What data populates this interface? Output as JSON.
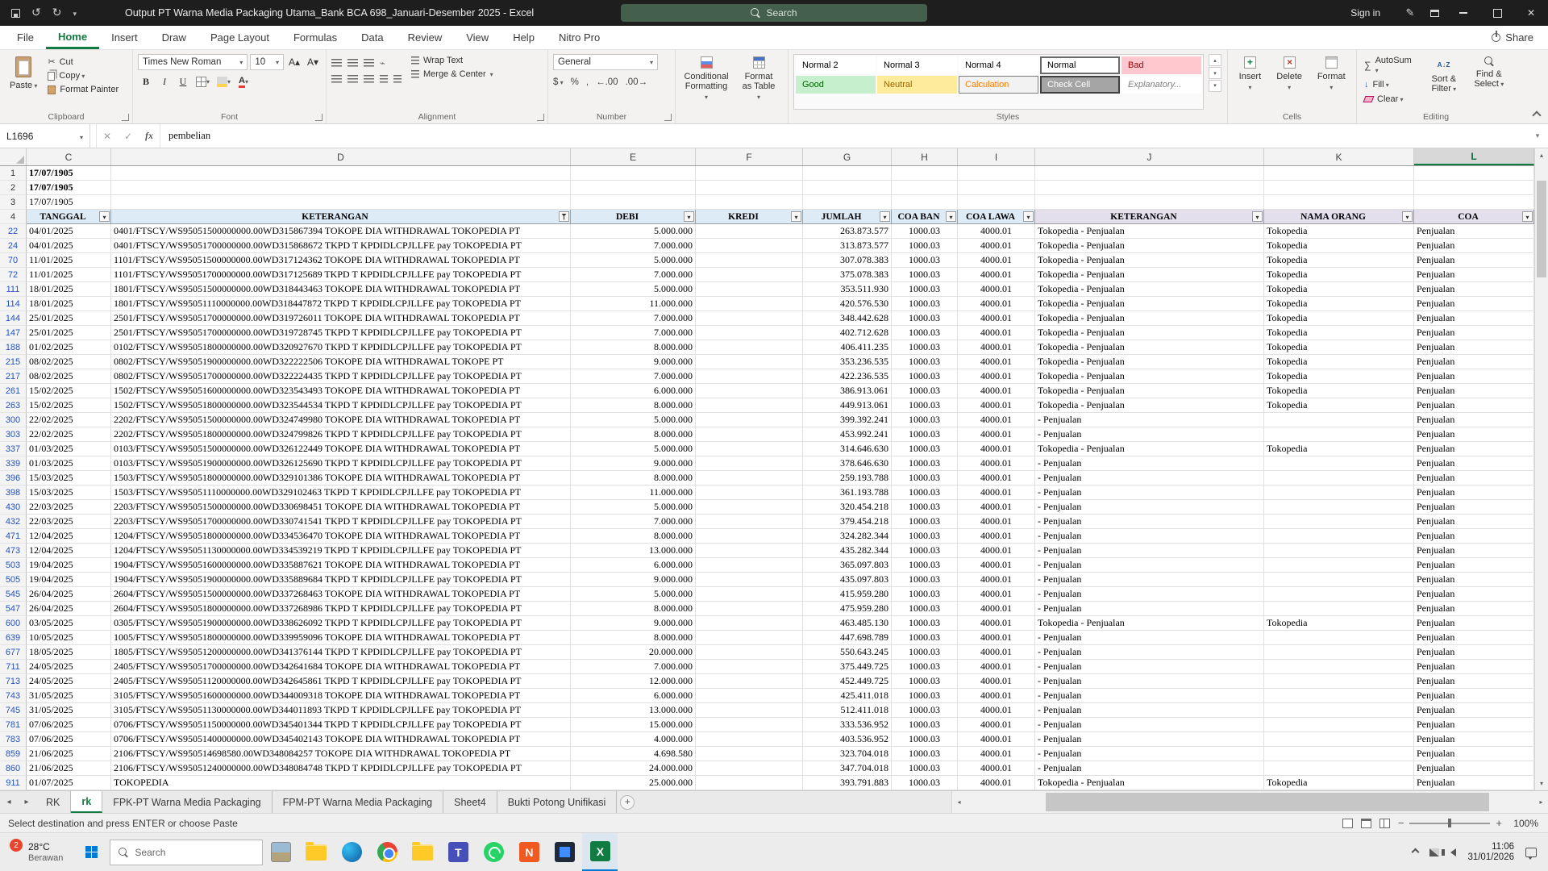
{
  "title_bar": {
    "title": "Output PT Warna Media Packaging Utama_Bank BCA 698_Januari-Desember 2025 - Excel",
    "search": "Search",
    "sign_in": "Sign in"
  },
  "ribbon": {
    "tabs": [
      "File",
      "Home",
      "Insert",
      "Draw",
      "Page Layout",
      "Formulas",
      "Data",
      "Review",
      "View",
      "Help",
      "Nitro Pro"
    ],
    "active_tab": "Home",
    "share": "Share",
    "clipboard": {
      "label": "Clipboard",
      "paste": "Paste",
      "cut": "Cut",
      "copy": "Copy",
      "painter": "Format Painter"
    },
    "font": {
      "label": "Font",
      "name": "Times New Roman",
      "size": "10",
      "bold": "B",
      "italic": "I",
      "underline": "U"
    },
    "alignment": {
      "label": "Alignment",
      "wrap": "Wrap Text",
      "merge": "Merge & Center"
    },
    "number": {
      "label": "Number",
      "format": "General"
    },
    "styles": {
      "label": "Styles",
      "conditional": "Conditional Formatting",
      "format_table": "Format as Table",
      "gallery": [
        [
          "Normal 2",
          "Normal 3",
          "Normal 4",
          "Normal",
          "Bad"
        ],
        [
          "Good",
          "Neutral",
          "Calculation",
          "Check Cell",
          "Explanatory..."
        ]
      ]
    },
    "cells": {
      "label": "Cells",
      "insert": "Insert",
      "delete": "Delete",
      "format": "Format"
    },
    "editing": {
      "label": "Editing",
      "autosum": "AutoSum",
      "fill": "Fill",
      "clear": "Clear",
      "sort": "Sort & Filter",
      "find": "Find & Select"
    }
  },
  "formula_bar": {
    "name_box": "L1696",
    "fx": "fx",
    "value": "pembelian"
  },
  "grid": {
    "columns": [
      "C",
      "D",
      "E",
      "F",
      "G",
      "H",
      "I",
      "J",
      "K",
      "L"
    ],
    "selected_column": "L",
    "header_row_num": "4",
    "headers": {
      "c": "TANGGAL",
      "d": "KETERANGAN",
      "e": "DEBI",
      "f": "KREDI",
      "g": "JUMLAH",
      "h": "COA BAN",
      "i": "COA LAWA",
      "j": "KETERANGAN",
      "k": "NAMA ORANG",
      "l": "COA"
    },
    "top_rows": [
      {
        "n": "1",
        "tanggal": "17/07/1905",
        "bold": true
      },
      {
        "n": "2",
        "tanggal": "17/07/1905",
        "bold": true
      },
      {
        "n": "3",
        "tanggal": "17/07/1905",
        "bold": false
      }
    ],
    "rows": [
      [
        "22",
        "04/01/2025",
        "0401/FTSCY/WS95051500000000.00WD315867394 TOKOPE DIA WITHDRAWAL TOKOPEDIA PT",
        "5.000.000",
        "",
        "263.873.577",
        "1000.03",
        "4000.01",
        "Tokopedia - Penjualan",
        "Tokopedia",
        "Penjualan"
      ],
      [
        "24",
        "04/01/2025",
        "0401/FTSCY/WS95051700000000.00WD315868672 TKPD T KPDIDLCPJLLFE pay TOKOPEDIA PT",
        "7.000.000",
        "",
        "313.873.577",
        "1000.03",
        "4000.01",
        "Tokopedia - Penjualan",
        "Tokopedia",
        "Penjualan"
      ],
      [
        "70",
        "11/01/2025",
        "1101/FTSCY/WS95051500000000.00WD317124362 TOKOPE DIA WITHDRAWAL TOKOPEDIA PT",
        "5.000.000",
        "",
        "307.078.383",
        "1000.03",
        "4000.01",
        "Tokopedia - Penjualan",
        "Tokopedia",
        "Penjualan"
      ],
      [
        "72",
        "11/01/2025",
        "1101/FTSCY/WS95051700000000.00WD317125689 TKPD T KPDIDLCPJLLFE pay TOKOPEDIA PT",
        "7.000.000",
        "",
        "375.078.383",
        "1000.03",
        "4000.01",
        "Tokopedia - Penjualan",
        "Tokopedia",
        "Penjualan"
      ],
      [
        "111",
        "18/01/2025",
        "1801/FTSCY/WS95051500000000.00WD318443463 TOKOPE DIA WITHDRAWAL TOKOPEDIA PT",
        "5.000.000",
        "",
        "353.511.930",
        "1000.03",
        "4000.01",
        "Tokopedia - Penjualan",
        "Tokopedia",
        "Penjualan"
      ],
      [
        "114",
        "18/01/2025",
        "1801/FTSCY/WS95051110000000.00WD318447872 TKPD T KPDIDLCPJLLFE pay TOKOPEDIA PT",
        "11.000.000",
        "",
        "420.576.530",
        "1000.03",
        "4000.01",
        "Tokopedia - Penjualan",
        "Tokopedia",
        "Penjualan"
      ],
      [
        "144",
        "25/01/2025",
        "2501/FTSCY/WS95051700000000.00WD319726011 TOKOPE DIA WITHDRAWAL TOKOPEDIA PT",
        "7.000.000",
        "",
        "348.442.628",
        "1000.03",
        "4000.01",
        "Tokopedia - Penjualan",
        "Tokopedia",
        "Penjualan"
      ],
      [
        "147",
        "25/01/2025",
        "2501/FTSCY/WS95051700000000.00WD319728745 TKPD T KPDIDLCPJLLFE pay TOKOPEDIA PT",
        "7.000.000",
        "",
        "402.712.628",
        "1000.03",
        "4000.01",
        "Tokopedia - Penjualan",
        "Tokopedia",
        "Penjualan"
      ],
      [
        "188",
        "01/02/2025",
        "0102/FTSCY/WS95051800000000.00WD320927670 TKPD T KPDIDLCPJLLFE pay TOKOPEDIA PT",
        "8.000.000",
        "",
        "406.411.235",
        "1000.03",
        "4000.01",
        "Tokopedia - Penjualan",
        "Tokopedia",
        "Penjualan"
      ],
      [
        "215",
        "08/02/2025",
        "0802/FTSCY/WS95051900000000.00WD322222506 TOKOPE DIA WITHDRAWAL TOKOPE PT",
        "9.000.000",
        "",
        "353.236.535",
        "1000.03",
        "4000.01",
        "Tokopedia - Penjualan",
        "Tokopedia",
        "Penjualan"
      ],
      [
        "217",
        "08/02/2025",
        "0802/FTSCY/WS95051700000000.00WD322224435 TKPD T KPDIDLCPJLLFE pay TOKOPEDIA PT",
        "7.000.000",
        "",
        "422.236.535",
        "1000.03",
        "4000.01",
        "Tokopedia - Penjualan",
        "Tokopedia",
        "Penjualan"
      ],
      [
        "261",
        "15/02/2025",
        "1502/FTSCY/WS95051600000000.00WD323543493 TOKOPE DIA WITHDRAWAL TOKOPEDIA PT",
        "6.000.000",
        "",
        "386.913.061",
        "1000.03",
        "4000.01",
        "Tokopedia - Penjualan",
        "Tokopedia",
        "Penjualan"
      ],
      [
        "263",
        "15/02/2025",
        "1502/FTSCY/WS95051800000000.00WD323544534 TKPD T KPDIDLCPJLLFE pay TOKOPEDIA PT",
        "8.000.000",
        "",
        "449.913.061",
        "1000.03",
        "4000.01",
        "Tokopedia - Penjualan",
        "Tokopedia",
        "Penjualan"
      ],
      [
        "300",
        "22/02/2025",
        "2202/FTSCY/WS95051500000000.00WD324749980 TOKOPE DIA WITHDRAWAL TOKOPEDIA PT",
        "5.000.000",
        "",
        "399.392.241",
        "1000.03",
        "4000.01",
        "- Penjualan",
        "",
        "Penjualan"
      ],
      [
        "303",
        "22/02/2025",
        "2202/FTSCY/WS95051800000000.00WD324799826 TKPD T KPDIDLCPJLLFE pay TOKOPEDIA PT",
        "8.000.000",
        "",
        "453.992.241",
        "1000.03",
        "4000.01",
        "- Penjualan",
        "",
        "Penjualan"
      ],
      [
        "337",
        "01/03/2025",
        "0103/FTSCY/WS95051500000000.00WD326122449 TOKOPE DIA WITHDRAWAL TOKOPEDIA PT",
        "5.000.000",
        "",
        "314.646.630",
        "1000.03",
        "4000.01",
        "Tokopedia - Penjualan",
        "Tokopedia",
        "Penjualan"
      ],
      [
        "339",
        "01/03/2025",
        "0103/FTSCY/WS95051900000000.00WD326125690 TKPD T KPDIDLCPJLLFE pay TOKOPEDIA PT",
        "9.000.000",
        "",
        "378.646.630",
        "1000.03",
        "4000.01",
        "- Penjualan",
        "",
        "Penjualan"
      ],
      [
        "396",
        "15/03/2025",
        "1503/FTSCY/WS95051800000000.00WD329101386 TOKOPE DIA WITHDRAWAL TOKOPEDIA PT",
        "8.000.000",
        "",
        "259.193.788",
        "1000.03",
        "4000.01",
        "- Penjualan",
        "",
        "Penjualan"
      ],
      [
        "398",
        "15/03/2025",
        "1503/FTSCY/WS95051110000000.00WD329102463 TKPD T KPDIDLCPJLLFE pay TOKOPEDIA PT",
        "11.000.000",
        "",
        "361.193.788",
        "1000.03",
        "4000.01",
        "- Penjualan",
        "",
        "Penjualan"
      ],
      [
        "430",
        "22/03/2025",
        "2203/FTSCY/WS95051500000000.00WD330698451 TOKOPE DIA WITHDRAWAL TOKOPEDIA PT",
        "5.000.000",
        "",
        "320.454.218",
        "1000.03",
        "4000.01",
        "- Penjualan",
        "",
        "Penjualan"
      ],
      [
        "432",
        "22/03/2025",
        "2203/FTSCY/WS95051700000000.00WD330741541 TKPD T KPDIDLCPJLLFE pay TOKOPEDIA PT",
        "7.000.000",
        "",
        "379.454.218",
        "1000.03",
        "4000.01",
        "- Penjualan",
        "",
        "Penjualan"
      ],
      [
        "471",
        "12/04/2025",
        "1204/FTSCY/WS95051800000000.00WD334536470 TOKOPE DIA WITHDRAWAL TOKOPEDIA PT",
        "8.000.000",
        "",
        "324.282.344",
        "1000.03",
        "4000.01",
        "- Penjualan",
        "",
        "Penjualan"
      ],
      [
        "473",
        "12/04/2025",
        "1204/FTSCY/WS95051130000000.00WD334539219 TKPD T KPDIDLCPJLLFE pay TOKOPEDIA PT",
        "13.000.000",
        "",
        "435.282.344",
        "1000.03",
        "4000.01",
        "- Penjualan",
        "",
        "Penjualan"
      ],
      [
        "503",
        "19/04/2025",
        "1904/FTSCY/WS95051600000000.00WD335887621 TOKOPE DIA WITHDRAWAL TOKOPEDIA PT",
        "6.000.000",
        "",
        "365.097.803",
        "1000.03",
        "4000.01",
        "- Penjualan",
        "",
        "Penjualan"
      ],
      [
        "505",
        "19/04/2025",
        "1904/FTSCY/WS95051900000000.00WD335889684 TKPD T KPDIDLCPJLLFE pay TOKOPEDIA PT",
        "9.000.000",
        "",
        "435.097.803",
        "1000.03",
        "4000.01",
        "- Penjualan",
        "",
        "Penjualan"
      ],
      [
        "545",
        "26/04/2025",
        "2604/FTSCY/WS95051500000000.00WD337268463 TOKOPE DIA WITHDRAWAL TOKOPEDIA PT",
        "5.000.000",
        "",
        "415.959.280",
        "1000.03",
        "4000.01",
        "- Penjualan",
        "",
        "Penjualan"
      ],
      [
        "547",
        "26/04/2025",
        "2604/FTSCY/WS95051800000000.00WD337268986 TKPD T KPDIDLCPJLLFE pay TOKOPEDIA PT",
        "8.000.000",
        "",
        "475.959.280",
        "1000.03",
        "4000.01",
        "- Penjualan",
        "",
        "Penjualan"
      ],
      [
        "600",
        "03/05/2025",
        "0305/FTSCY/WS95051900000000.00WD338626092 TKPD T KPDIDLCPJLLFE pay TOKOPEDIA PT",
        "9.000.000",
        "",
        "463.485.130",
        "1000.03",
        "4000.01",
        "Tokopedia - Penjualan",
        "Tokopedia",
        "Penjualan"
      ],
      [
        "639",
        "10/05/2025",
        "1005/FTSCY/WS95051800000000.00WD339959096 TOKOPE DIA WITHDRAWAL TOKOPEDIA PT",
        "8.000.000",
        "",
        "447.698.789",
        "1000.03",
        "4000.01",
        "- Penjualan",
        "",
        "Penjualan"
      ],
      [
        "677",
        "18/05/2025",
        "1805/FTSCY/WS95051200000000.00WD341376144 TKPD T KPDIDLCPJLLFE pay TOKOPEDIA PT",
        "20.000.000",
        "",
        "550.643.245",
        "1000.03",
        "4000.01",
        "- Penjualan",
        "",
        "Penjualan"
      ],
      [
        "711",
        "24/05/2025",
        "2405/FTSCY/WS95051700000000.00WD342641684 TOKOPE DIA WITHDRAWAL TOKOPEDIA PT",
        "7.000.000",
        "",
        "375.449.725",
        "1000.03",
        "4000.01",
        "- Penjualan",
        "",
        "Penjualan"
      ],
      [
        "713",
        "24/05/2025",
        "2405/FTSCY/WS95051120000000.00WD342645861 TKPD T KPDIDLCPJLLFE pay TOKOPEDIA PT",
        "12.000.000",
        "",
        "452.449.725",
        "1000.03",
        "4000.01",
        "- Penjualan",
        "",
        "Penjualan"
      ],
      [
        "743",
        "31/05/2025",
        "3105/FTSCY/WS95051600000000.00WD344009318 TOKOPE DIA WITHDRAWAL TOKOPEDIA PT",
        "6.000.000",
        "",
        "425.411.018",
        "1000.03",
        "4000.01",
        "- Penjualan",
        "",
        "Penjualan"
      ],
      [
        "745",
        "31/05/2025",
        "3105/FTSCY/WS95051130000000.00WD344011893 TKPD T KPDIDLCPJLLFE pay TOKOPEDIA PT",
        "13.000.000",
        "",
        "512.411.018",
        "1000.03",
        "4000.01",
        "- Penjualan",
        "",
        "Penjualan"
      ],
      [
        "781",
        "07/06/2025",
        "0706/FTSCY/WS95051150000000.00WD345401344 TKPD T KPDIDLCPJLLFE pay TOKOPEDIA PT",
        "15.000.000",
        "",
        "333.536.952",
        "1000.03",
        "4000.01",
        "- Penjualan",
        "",
        "Penjualan"
      ],
      [
        "783",
        "07/06/2025",
        "0706/FTSCY/WS95051400000000.00WD345402143 TOKOPE DIA WITHDRAWAL TOKOPEDIA PT",
        "4.000.000",
        "",
        "403.536.952",
        "1000.03",
        "4000.01",
        "- Penjualan",
        "",
        "Penjualan"
      ],
      [
        "859",
        "21/06/2025",
        "2106/FTSCY/WS950514698580.00WD348084257 TOKOPE DIA WITHDRAWAL TOKOPEDIA PT",
        "4.698.580",
        "",
        "323.704.018",
        "1000.03",
        "4000.01",
        "- Penjualan",
        "",
        "Penjualan"
      ],
      [
        "860",
        "21/06/2025",
        "2106/FTSCY/WS95051240000000.00WD348084748 TKPD T KPDIDLCPJLLFE pay TOKOPEDIA PT",
        "24.000.000",
        "",
        "347.704.018",
        "1000.03",
        "4000.01",
        "- Penjualan",
        "",
        "Penjualan"
      ],
      [
        "911",
        "01/07/2025",
        "TOKOPEDIA",
        "25.000.000",
        "",
        "393.791.883",
        "1000.03",
        "4000.01",
        "Tokopedia - Penjualan",
        "Tokopedia",
        "Penjualan"
      ]
    ]
  },
  "sheet_bar": {
    "tabs": [
      "RK",
      "rk",
      "FPK-PT Warna Media Packaging",
      "FPM-PT Warna Media Packaging",
      "Sheet4",
      "Bukti Potong Unifikasi"
    ],
    "active_index": 1
  },
  "status_bar": {
    "message": "Select destination and press ENTER or choose Paste",
    "zoom": "100%"
  },
  "taskbar": {
    "badge": "2",
    "temp": "28°C",
    "weather": "Berawan",
    "search": "Search",
    "time": "11:06",
    "date": "31/01/2026"
  }
}
